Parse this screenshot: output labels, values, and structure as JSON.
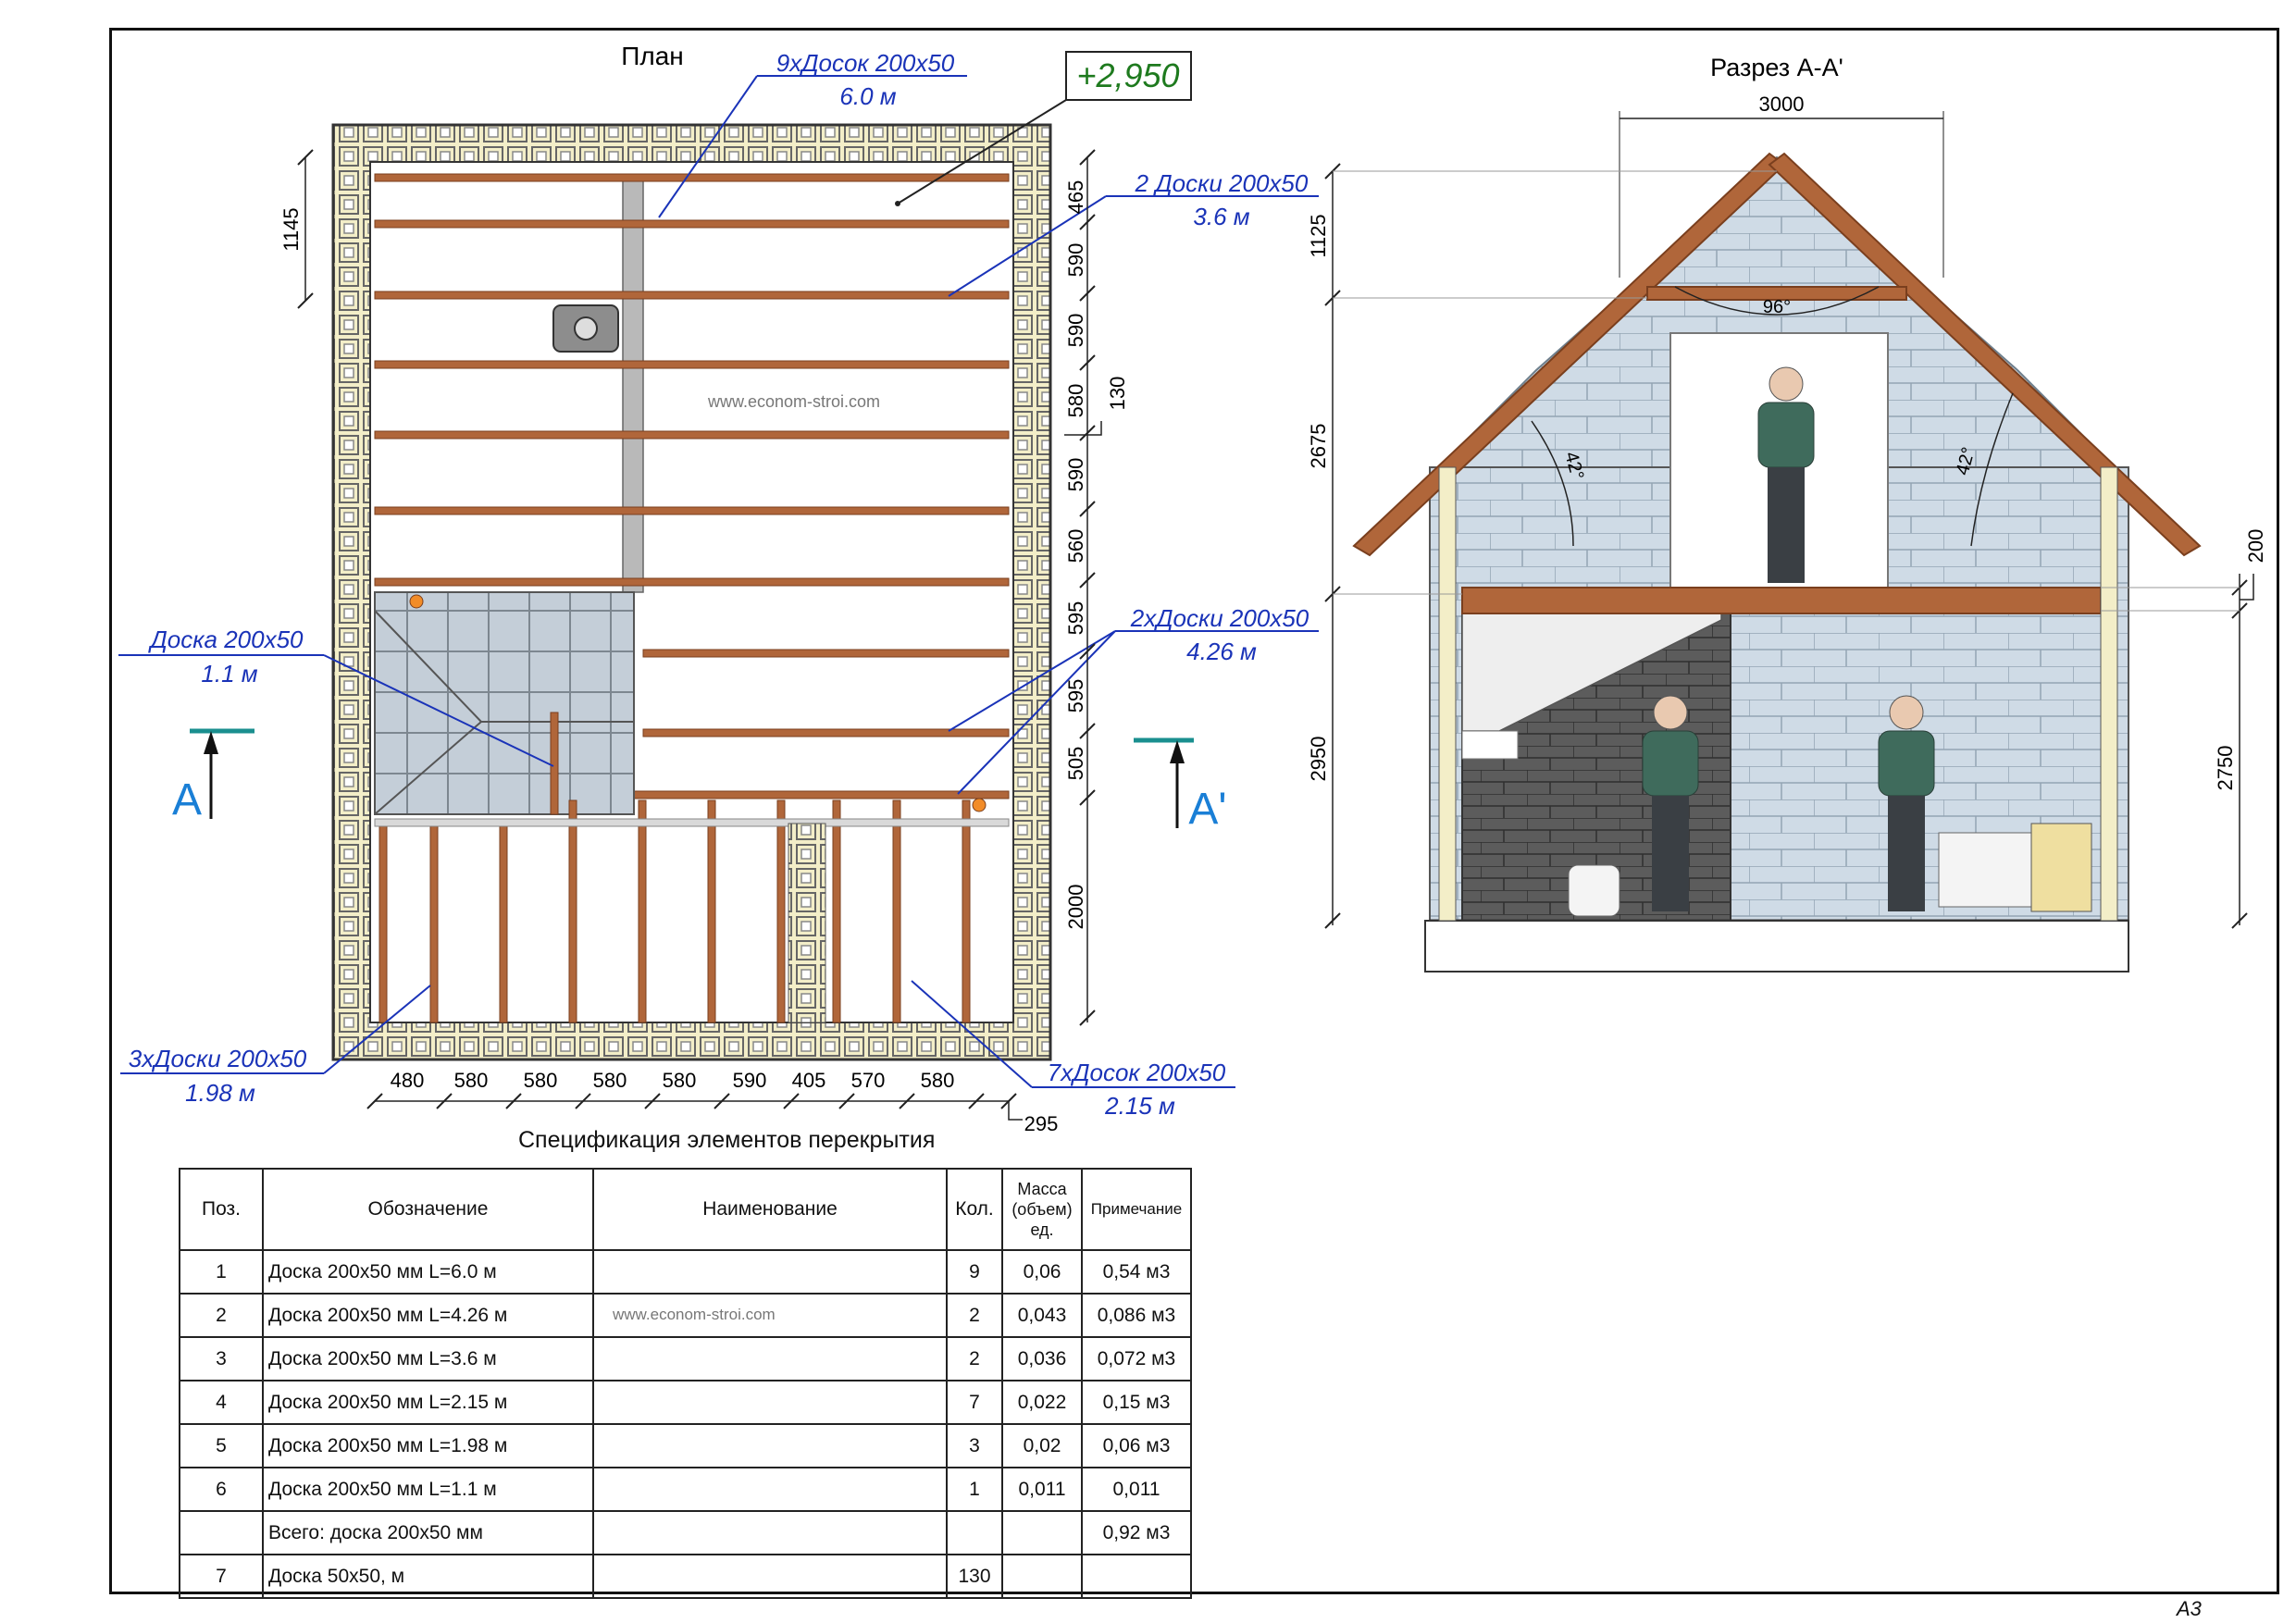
{
  "plan": {
    "title": "План",
    "level": "+2,950",
    "watermark": "www.econom-stroi.com",
    "callouts": {
      "c1_line1": "9хДосок 200х50",
      "c1_line2": "6.0 м",
      "c2_line1": "2 Доски 200х50",
      "c2_line2": "3.6 м",
      "c3_line1": "Доска 200х50",
      "c3_line2": "1.1 м",
      "c4_line1": "2хДоски 200х50",
      "c4_line2": "4.26 м",
      "c5_line1": "3хДоски 200х50",
      "c5_line2": "1.98 м",
      "c6_line1": "7хДосок 200х50",
      "c6_line2": "2.15 м"
    },
    "dims_left": [
      "1145"
    ],
    "dims_right": [
      "465",
      "590",
      "590",
      "580",
      "590",
      "560",
      "595",
      "595",
      "505",
      "2000"
    ],
    "dim_130": "130",
    "dims_bottom": [
      "480",
      "580",
      "580",
      "580",
      "580",
      "590",
      "405",
      "570",
      "580"
    ],
    "dim_295": "295",
    "section_marker_left": "A",
    "section_marker_right": "A'"
  },
  "section": {
    "title": "Разрез А-А'",
    "width_dim": "3000",
    "left_dims": [
      "1125",
      "2675",
      "2950"
    ],
    "right_dims": [
      "200",
      "2750"
    ],
    "angle_top": "96°",
    "angle_left": "42°",
    "angle_right": "42°"
  },
  "spec": {
    "title": "Спецификация элементов перекрытия",
    "watermark": "www.econom-stroi.com",
    "headers": {
      "pos": "Поз.",
      "designation": "Обозначение",
      "name": "Наименование",
      "qty": "Кол.",
      "mass_l1": "Масса",
      "mass_l2": "(объем)",
      "mass_l3": "ед.",
      "note": "Примечание"
    },
    "rows": [
      {
        "pos": "1",
        "designation": "Доска 200х50 мм L=6.0 м",
        "name": "",
        "qty": "9",
        "mass": "0,06",
        "note": "0,54 м3"
      },
      {
        "pos": "2",
        "designation": "Доска 200х50 мм L=4.26 м",
        "name": "",
        "qty": "2",
        "mass": "0,043",
        "note": "0,086 м3"
      },
      {
        "pos": "3",
        "designation": "Доска 200х50 мм L=3.6 м",
        "name": "",
        "qty": "2",
        "mass": "0,036",
        "note": "0,072 м3"
      },
      {
        "pos": "4",
        "designation": "Доска 200х50 мм L=2.15 м",
        "name": "",
        "qty": "7",
        "mass": "0,022",
        "note": "0,15 м3"
      },
      {
        "pos": "5",
        "designation": "Доска 200х50 мм L=1.98 м",
        "name": "",
        "qty": "3",
        "mass": "0,02",
        "note": "0,06 м3"
      },
      {
        "pos": "6",
        "designation": "Доска 200х50 мм L=1.1 м",
        "name": "",
        "qty": "1",
        "mass": "0,011",
        "note": "0,011"
      },
      {
        "pos": "",
        "designation": "Всего: доска 200х50 мм",
        "name": "",
        "qty": "",
        "mass": "",
        "note": "0,92 м3"
      },
      {
        "pos": "7",
        "designation": "Доска 50х50, м",
        "name": "",
        "qty": "130",
        "mass": "",
        "note": ""
      }
    ]
  },
  "sheet": "А3",
  "colors": {
    "beam": "#b0663a",
    "beam_dark": "#7a3f1e",
    "callout": "#1a33b8",
    "level": "#1e7a1e",
    "section_marker": "#1a7fd6",
    "brick_light": "#cfdbe6",
    "brick_dark": "#5c5c5c",
    "block_yellow": "#f3eec8"
  }
}
